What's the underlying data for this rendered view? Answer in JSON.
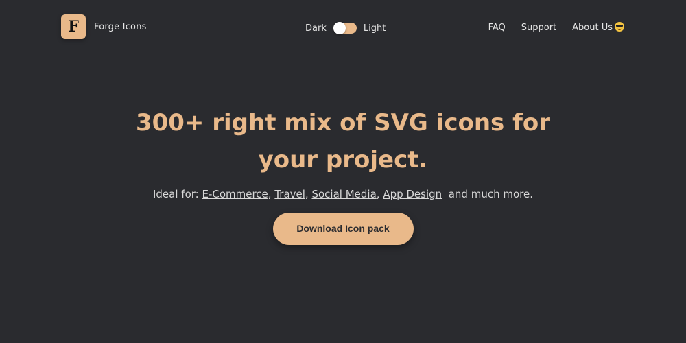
{
  "brand": {
    "logo_letter": "F",
    "name": "Forge Icons"
  },
  "theme_toggle": {
    "left_label": "Dark",
    "right_label": "Light"
  },
  "nav": {
    "faq": "FAQ",
    "support": "Support",
    "about": "About Us",
    "about_icon": "sunglasses-emoji-icon"
  },
  "hero": {
    "title": "300+ right mix of SVG icons for your project.",
    "ideal_prefix": "Ideal for: ",
    "categories": [
      "E-Commerce",
      "Travel",
      "Social Media",
      "App Design"
    ],
    "ideal_suffix": "and much more.",
    "cta_label": "Download Icon pack"
  },
  "colors": {
    "background": "#2a2b2f",
    "accent": "#e9b98a",
    "text": "#e6e6e6"
  }
}
